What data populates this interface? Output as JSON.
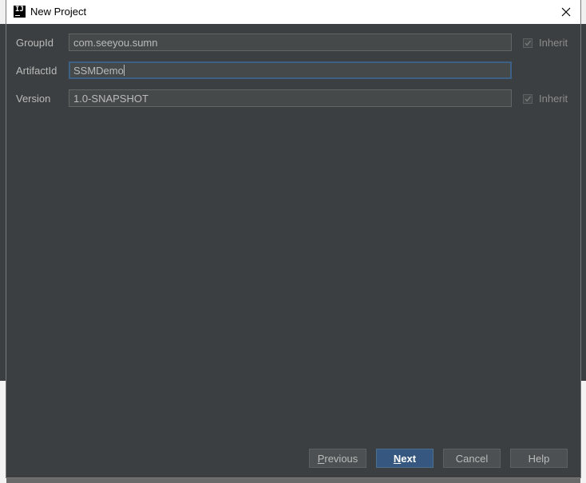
{
  "window": {
    "title": "New Project",
    "app_icon": "intellij-idea-icon"
  },
  "form": {
    "group_id": {
      "label": "GroupId",
      "value": "com.seeyou.sumn",
      "inherit_label": "Inherit",
      "inherit_checked": true
    },
    "artifact_id": {
      "label": "ArtifactId",
      "value": "SSMDemo"
    },
    "version": {
      "label": "Version",
      "value": "1.0-SNAPSHOT",
      "inherit_label": "Inherit",
      "inherit_checked": true
    }
  },
  "buttons": {
    "previous": {
      "mnemonic": "P",
      "rest": "revious"
    },
    "next": {
      "mnemonic": "N",
      "rest": "ext"
    },
    "cancel": "Cancel",
    "help": "Help"
  },
  "colors": {
    "dialog_bg": "#3c3f41",
    "field_bg": "#45494a",
    "primary_button": "#365880",
    "focus_border": "#3d6185"
  }
}
